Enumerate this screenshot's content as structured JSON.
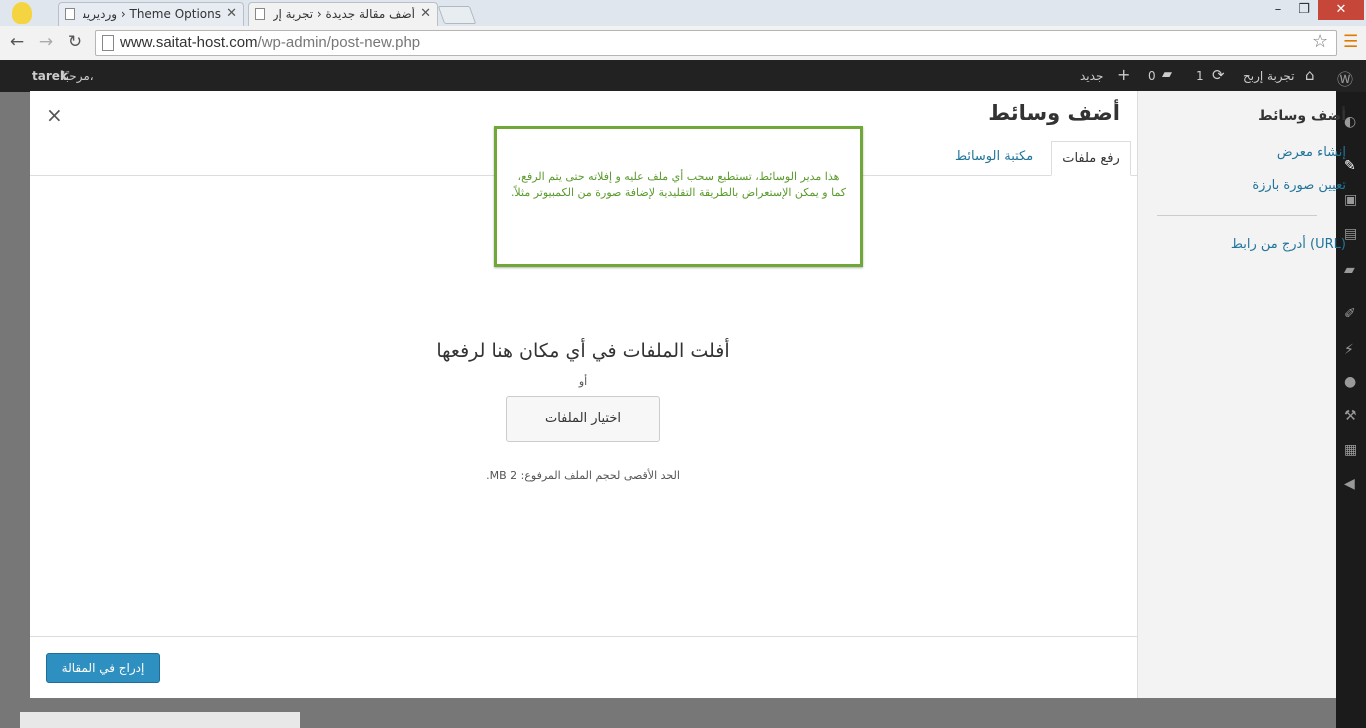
{
  "browser": {
    "tabs": [
      {
        "title": "Theme Options ‹ ورديريس"
      },
      {
        "title": "أضف مقالة جديدة ‹ تجربة إر"
      }
    ],
    "url_host": "www.saitat-host.com",
    "url_path": "/wp-admin/post-new.php",
    "window_controls": {
      "minimize": "–",
      "restore": "❐",
      "close": "✕"
    }
  },
  "adminbar": {
    "site_name": "تجربة إربح",
    "updates_count": "1",
    "comments_count": "0",
    "new_label": "جديد",
    "greeting": "مرحبًا،",
    "username": "tarek"
  },
  "media_menu": {
    "title": "أضف وسائط",
    "items": [
      "إنشاء معرض",
      "تعيين صورة بارزة"
    ],
    "url_item": "أدرج من رابط (URL)"
  },
  "frame": {
    "title": "أضف وسائط",
    "tabs": [
      "رفع ملفات",
      "مكتبة الوسائط"
    ],
    "tooltip": "هذا مدير الوسائط، تستطيع سحب أي ملف عليه و إفلاته حتى يتم الرفع، كما و يمكن الإستعراض بالطريقة التقليدية لإضافة صورة من الكمبيوتر مثلاً.",
    "drop_instructions": "أفلت الملفات في أي مكان هنا لرفعها",
    "or_label": "أو",
    "select_files_button": "اختيار الملفات",
    "max_size": "الحد الأقصى لحجم الملف المرفوع: 2 MB.",
    "insert_button": "إدراج في المقالة",
    "close_symbol": "×"
  },
  "accent_colors": {
    "link": "#21759b",
    "primary_button": "#2e8fc1",
    "tooltip_border": "#6fa839",
    "adminbar": "#222222"
  }
}
